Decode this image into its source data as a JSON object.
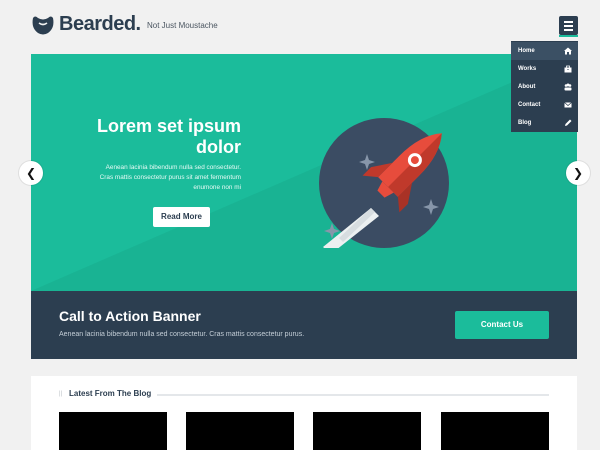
{
  "header": {
    "brand": "Bearded.",
    "tagline": "Not Just Moustache",
    "logo_icon": "beard-icon",
    "menu_icon": "hamburger-icon"
  },
  "nav": {
    "items": [
      {
        "label": "Home",
        "icon": "home-icon",
        "active": true
      },
      {
        "label": "Works",
        "icon": "briefcase-icon"
      },
      {
        "label": "About",
        "icon": "users-icon"
      },
      {
        "label": "Contact",
        "icon": "envelope-icon"
      },
      {
        "label": "Blog",
        "icon": "pencil-icon"
      }
    ]
  },
  "hero": {
    "title": "Lorem set ipsum dolor",
    "text": "Aenean lacinia bibendum nulla sed consectetur. Cras mattis consectetur purus sit amet fermentum enumone non mi",
    "button": "Read More",
    "art": "rocket-illustration",
    "prev_icon": "chevron-left-icon",
    "next_icon": "chevron-right-icon"
  },
  "cta": {
    "title": "Call to Action Banner",
    "text": "Aenean lacinia bibendum nulla sed consectetur. Cras mattis consectetur purus.",
    "button": "Contact Us"
  },
  "blog": {
    "marker": "||",
    "title": "Latest From The Blog",
    "posts": [
      {},
      {},
      {},
      {}
    ]
  },
  "colors": {
    "accent": "#1bbc9b",
    "dark": "#2c3e50",
    "rocket": "#e74c3c",
    "background": "#f1f1f1"
  }
}
